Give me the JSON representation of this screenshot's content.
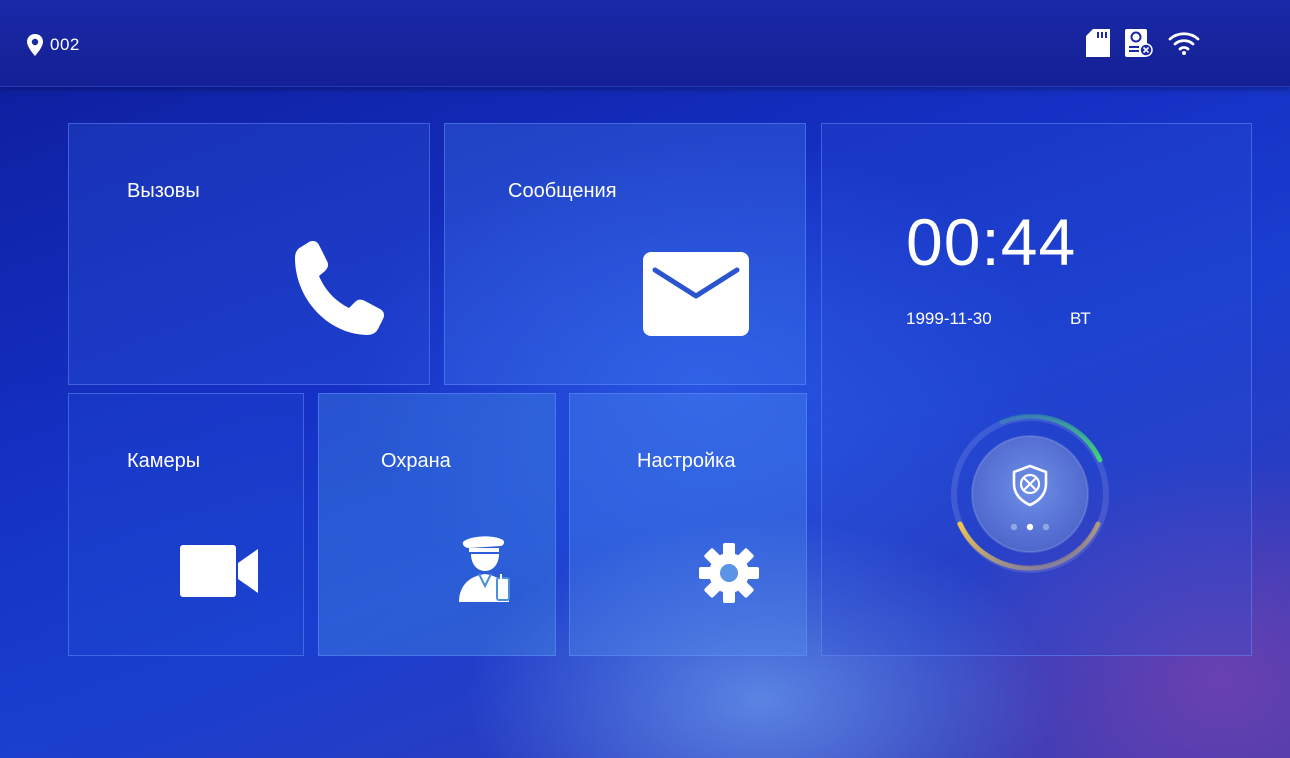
{
  "status_bar": {
    "location_number": "002",
    "icons": [
      "location-pin-icon",
      "sd-card-icon",
      "doorbell-offline-icon",
      "wifi-icon"
    ]
  },
  "tiles": {
    "calls": {
      "label": "Вызовы",
      "icon": "phone-icon"
    },
    "messages": {
      "label": "Сообщения",
      "icon": "envelope-icon"
    },
    "cameras": {
      "label": "Камеры",
      "icon": "video-camera-icon"
    },
    "security": {
      "label": "Охрана",
      "icon": "guard-icon"
    },
    "settings": {
      "label": "Настройка",
      "icon": "gear-icon"
    }
  },
  "clock": {
    "time": "00:44",
    "date": "1999-11-30",
    "weekday": "ВТ"
  },
  "arming": {
    "icon": "shield-disarmed-icon",
    "page_dots": 3,
    "active_dot": 2
  },
  "colors": {
    "accent_green": "#3fd27a",
    "accent_yellow": "#f2c54a",
    "background": "#1530c4"
  }
}
